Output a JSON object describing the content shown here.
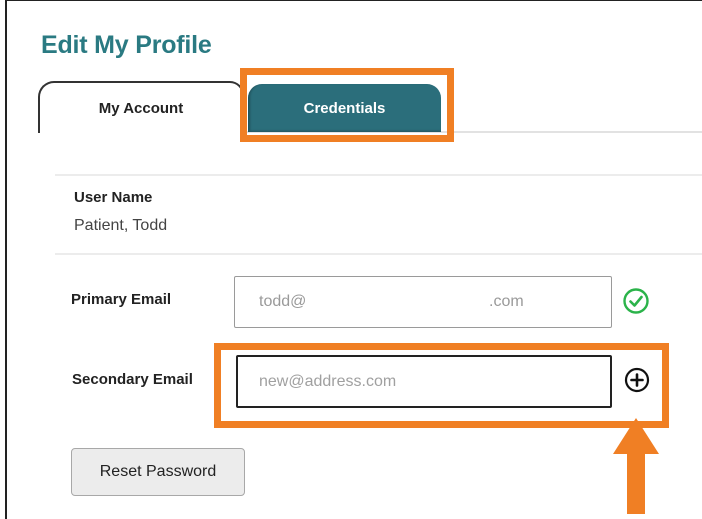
{
  "page": {
    "title": "Edit My Profile"
  },
  "tabs": [
    {
      "label": "My Account",
      "active": false
    },
    {
      "label": "Credentials",
      "active": true
    }
  ],
  "user_name": {
    "label": "User Name",
    "value": "Patient, Todd"
  },
  "primary_email": {
    "label": "Primary Email",
    "value_local": "todd@",
    "value_domain": ".com",
    "status_icon": "check-circle-icon"
  },
  "secondary_email": {
    "label": "Secondary Email",
    "value": "",
    "placeholder": "new@address.com",
    "action_icon": "plus-circle-icon"
  },
  "reset_password": {
    "label": "Reset Password"
  },
  "colors": {
    "title": "#2a7a82",
    "active_tab": "#2b6e7b",
    "highlight": "#f07f24",
    "check": "#2bb34a"
  },
  "annotations": {
    "highlight_tab": "credentials-tab",
    "highlight_field": "secondary-email-row",
    "arrow_direction": "up",
    "arrow_target": "add-email-button"
  }
}
